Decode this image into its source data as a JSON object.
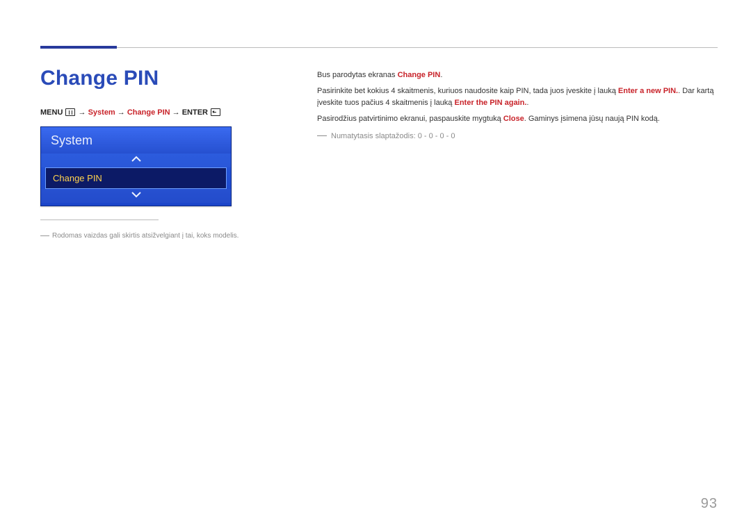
{
  "page": {
    "number": "93",
    "heading": "Change PIN"
  },
  "breadcrumb": {
    "menu_label": "MENU",
    "arrow": "→",
    "system": "System",
    "change_pin": "Change PIN",
    "enter_label": "ENTER"
  },
  "osd": {
    "title": "System",
    "selected_item": "Change PIN"
  },
  "footnote": {
    "text": "Rodomas vaizdas gali skirtis atsižvelgiant į tai, koks modelis."
  },
  "body": {
    "p1_prefix": "Bus parodytas ekranas ",
    "p1_hl": "Change PIN",
    "p1_suffix": ".",
    "p2_prefix": "Pasirinkite bet kokius 4 skaitmenis, kuriuos naudosite kaip PIN, tada juos įveskite į lauką ",
    "p2_hl1": "Enter a new PIN.",
    "p2_mid": ". Dar kartą įveskite tuos pačius 4 skaitmenis į lauką ",
    "p2_hl2": "Enter the PIN again.",
    "p2_suffix": ".",
    "p3_prefix": "Pasirodžius patvirtinimo ekranui, paspauskite mygtuką ",
    "p3_hl": "Close",
    "p3_suffix": ". Gaminys įsimena jūsų naują PIN kodą.",
    "default_note": "Numatytasis slaptažodis: 0 - 0 - 0 - 0"
  }
}
